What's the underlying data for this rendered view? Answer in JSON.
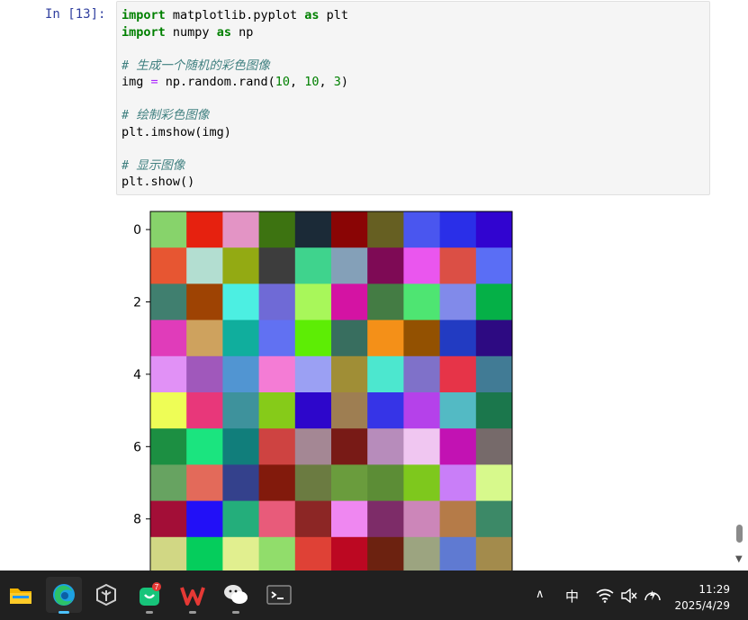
{
  "notebook": {
    "prompt": "In  [13]:",
    "code_lines": [
      [
        {
          "t": "import",
          "c": "kw"
        },
        {
          "t": " matplotlib.pyplot ",
          "c": "fn"
        },
        {
          "t": "as",
          "c": "kw"
        },
        {
          "t": " plt",
          "c": "fn"
        }
      ],
      [
        {
          "t": "import",
          "c": "kw"
        },
        {
          "t": " numpy ",
          "c": "fn"
        },
        {
          "t": "as",
          "c": "kw"
        },
        {
          "t": " np",
          "c": "fn"
        }
      ],
      [],
      [
        {
          "t": "# 生成一个随机的彩色图像",
          "c": "cm"
        }
      ],
      [
        {
          "t": "img ",
          "c": "fn"
        },
        {
          "t": "=",
          "c": "op"
        },
        {
          "t": " np.random.rand(",
          "c": "fn"
        },
        {
          "t": "10",
          "c": "num"
        },
        {
          "t": ", ",
          "c": "fn"
        },
        {
          "t": "10",
          "c": "num"
        },
        {
          "t": ", ",
          "c": "fn"
        },
        {
          "t": "3",
          "c": "num"
        },
        {
          "t": ")",
          "c": "fn"
        }
      ],
      [],
      [
        {
          "t": "# 绘制彩色图像",
          "c": "cm"
        }
      ],
      [
        {
          "t": "plt.imshow(img)",
          "c": "fn"
        }
      ],
      [],
      [
        {
          "t": "# 显示图像",
          "c": "cm"
        }
      ],
      [
        {
          "t": "plt.show()",
          "c": "fn"
        }
      ]
    ]
  },
  "chart_data": {
    "type": "heatmap",
    "title": "",
    "xlabel": "",
    "ylabel": "",
    "y_ticks": [
      0,
      2,
      4,
      6,
      8
    ],
    "rows": 10,
    "cols": 10,
    "visible_rows": 10,
    "cells": [
      [
        "#87d36b",
        "#e6210f",
        "#e394c5",
        "#3d7311",
        "#1b2a37",
        "#8a0505",
        "#665f22",
        "#4a56ef",
        "#2a2fe8",
        "#3104d0"
      ],
      [
        "#e75632",
        "#b3ded1",
        "#93aa13",
        "#3d3d3d",
        "#3fd38d",
        "#84a0b8",
        "#7e0a55",
        "#ea56ee",
        "#db4f45",
        "#5a6ef5"
      ],
      [
        "#407f6f",
        "#9e4303",
        "#4cefe2",
        "#6f6ad6",
        "#a8f75a",
        "#d413a3",
        "#447c44",
        "#4ee572",
        "#818aea",
        "#05b047"
      ],
      [
        "#e03cba",
        "#cea25e",
        "#10ae9d",
        "#6171f2",
        "#5ded05",
        "#386e5f",
        "#f49018",
        "#935101",
        "#223bc2",
        "#2d0a82"
      ],
      [
        "#e191f6",
        "#a058bb",
        "#5195d2",
        "#f47cd5",
        "#9ba0f3",
        "#a08e36",
        "#4ce7cf",
        "#7f71c9",
        "#e63448",
        "#417b95"
      ],
      [
        "#eefd56",
        "#e8377a",
        "#3e929c",
        "#86cb19",
        "#2d06cb",
        "#9e7e52",
        "#3634e7",
        "#b541ea",
        "#53bac4",
        "#1b774c"
      ],
      [
        "#1c8f42",
        "#1be47f",
        "#117e7b",
        "#ce4341",
        "#a48794",
        "#781a16",
        "#b78cbb",
        "#f0c6f1",
        "#c212b3",
        "#766a6a"
      ],
      [
        "#67a361",
        "#e36a5a",
        "#34418c",
        "#821a0c",
        "#6b7b41",
        "#6a9c3d",
        "#5c8d36",
        "#7ec81d",
        "#c97ef8",
        "#d7f98c"
      ],
      [
        "#a30e37",
        "#2210f7",
        "#24ae7b",
        "#e85b7a",
        "#8c2625",
        "#ef87f1",
        "#7d2c68",
        "#cc86b9",
        "#b57b48",
        "#3c8967"
      ],
      [
        "#d1d784",
        "#05cd5c",
        "#e1ef8f",
        "#91dd6b",
        "#df4136",
        "#bc0822",
        "#6c2210",
        "#9ca480",
        "#5f7ad2",
        "#a38b4c"
      ]
    ]
  },
  "taskbar": {
    "apps": [
      {
        "name": "file-explorer",
        "icon": "folder-icon"
      },
      {
        "name": "edge",
        "icon": "edge-icon"
      },
      {
        "name": "app-3",
        "icon": "cube-icon"
      },
      {
        "name": "shopping",
        "icon": "bag-icon",
        "badge": "7"
      },
      {
        "name": "wps",
        "icon": "wps-icon"
      },
      {
        "name": "wechat",
        "icon": "wechat-icon"
      },
      {
        "name": "terminal",
        "icon": "terminal-icon"
      }
    ],
    "tray": {
      "chevron": "∧",
      "ime": "中",
      "time": "11:29",
      "date": "2025/4/29"
    }
  }
}
